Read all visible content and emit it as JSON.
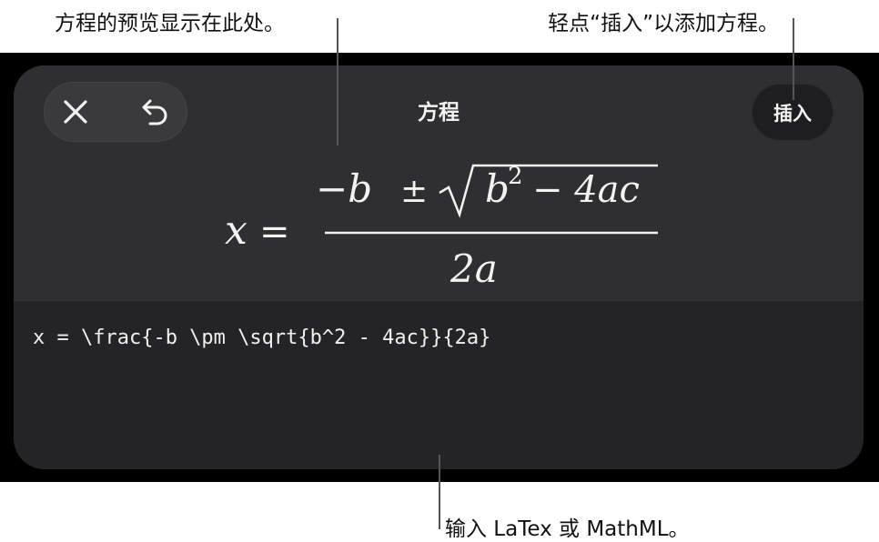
{
  "callouts": {
    "preview": "方程的预览显示在此处。",
    "insert": "轻点“插入”以添加方程。",
    "input": "输入 LaTex 或 MathML。"
  },
  "sheet": {
    "title": "方程",
    "insert_label": "插入",
    "close_icon": "close-icon",
    "undo_icon": "undo-icon"
  },
  "equation_preview": {
    "lhs": "x",
    "equals": "=",
    "numerator_minus_b": "−b",
    "plus_minus": "±",
    "radicand_b": "b",
    "exponent": "2",
    "radicand_rest": "− 4ac",
    "denominator": "2a"
  },
  "editor": {
    "latex": "x = \\frac{-b \\pm \\sqrt{b^2 - 4ac}}{2a}"
  },
  "colors": {
    "sheet_bg": "#2c2c2e",
    "editor_bg": "#242426",
    "text": "#f2f2f2"
  }
}
